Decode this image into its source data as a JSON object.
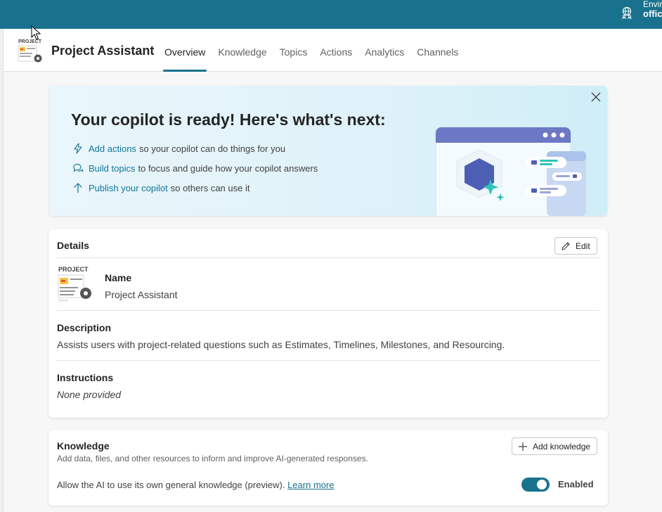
{
  "topbar": {
    "environment_label": "Envir",
    "environment_value": "offic",
    "environment_icon": "globe-people-icon",
    "color": "#19728d"
  },
  "header": {
    "title": "Project Assistant",
    "tabs": [
      {
        "label": "Overview",
        "active": true
      },
      {
        "label": "Knowledge",
        "active": false
      },
      {
        "label": "Topics",
        "active": false
      },
      {
        "label": "Actions",
        "active": false
      },
      {
        "label": "Analytics",
        "active": false
      },
      {
        "label": "Channels",
        "active": false
      }
    ]
  },
  "icon_text": "PROJECT",
  "banner": {
    "title": "Your copilot is ready! Here's what's next:",
    "steps": [
      {
        "icon": "lightning-icon",
        "link": "Add actions",
        "text": "so your copilot can do things for you"
      },
      {
        "icon": "chat-bubbles-icon",
        "link": "Build topics",
        "text": "to focus and guide how your copilot answers"
      },
      {
        "icon": "arrow-up-icon",
        "link": "Publish your copilot",
        "text": "so others can use it"
      }
    ]
  },
  "details": {
    "header": "Details",
    "edit_label": "Edit",
    "name_label": "Name",
    "name_value": "Project Assistant",
    "description_label": "Description",
    "description_value": "Assists users with project-related questions such as Estimates, Timelines, Milestones, and Resourcing.",
    "instructions_label": "Instructions",
    "instructions_value": "None provided"
  },
  "knowledge": {
    "header": "Knowledge",
    "add_label": "Add knowledge",
    "subtitle": "Add data, files, and other resources to inform and improve AI-generated responses.",
    "allow_text": "Allow the AI to use its own general knowledge (preview).",
    "learn_more": "Learn more",
    "toggle_on": true,
    "toggle_label": "Enabled"
  }
}
